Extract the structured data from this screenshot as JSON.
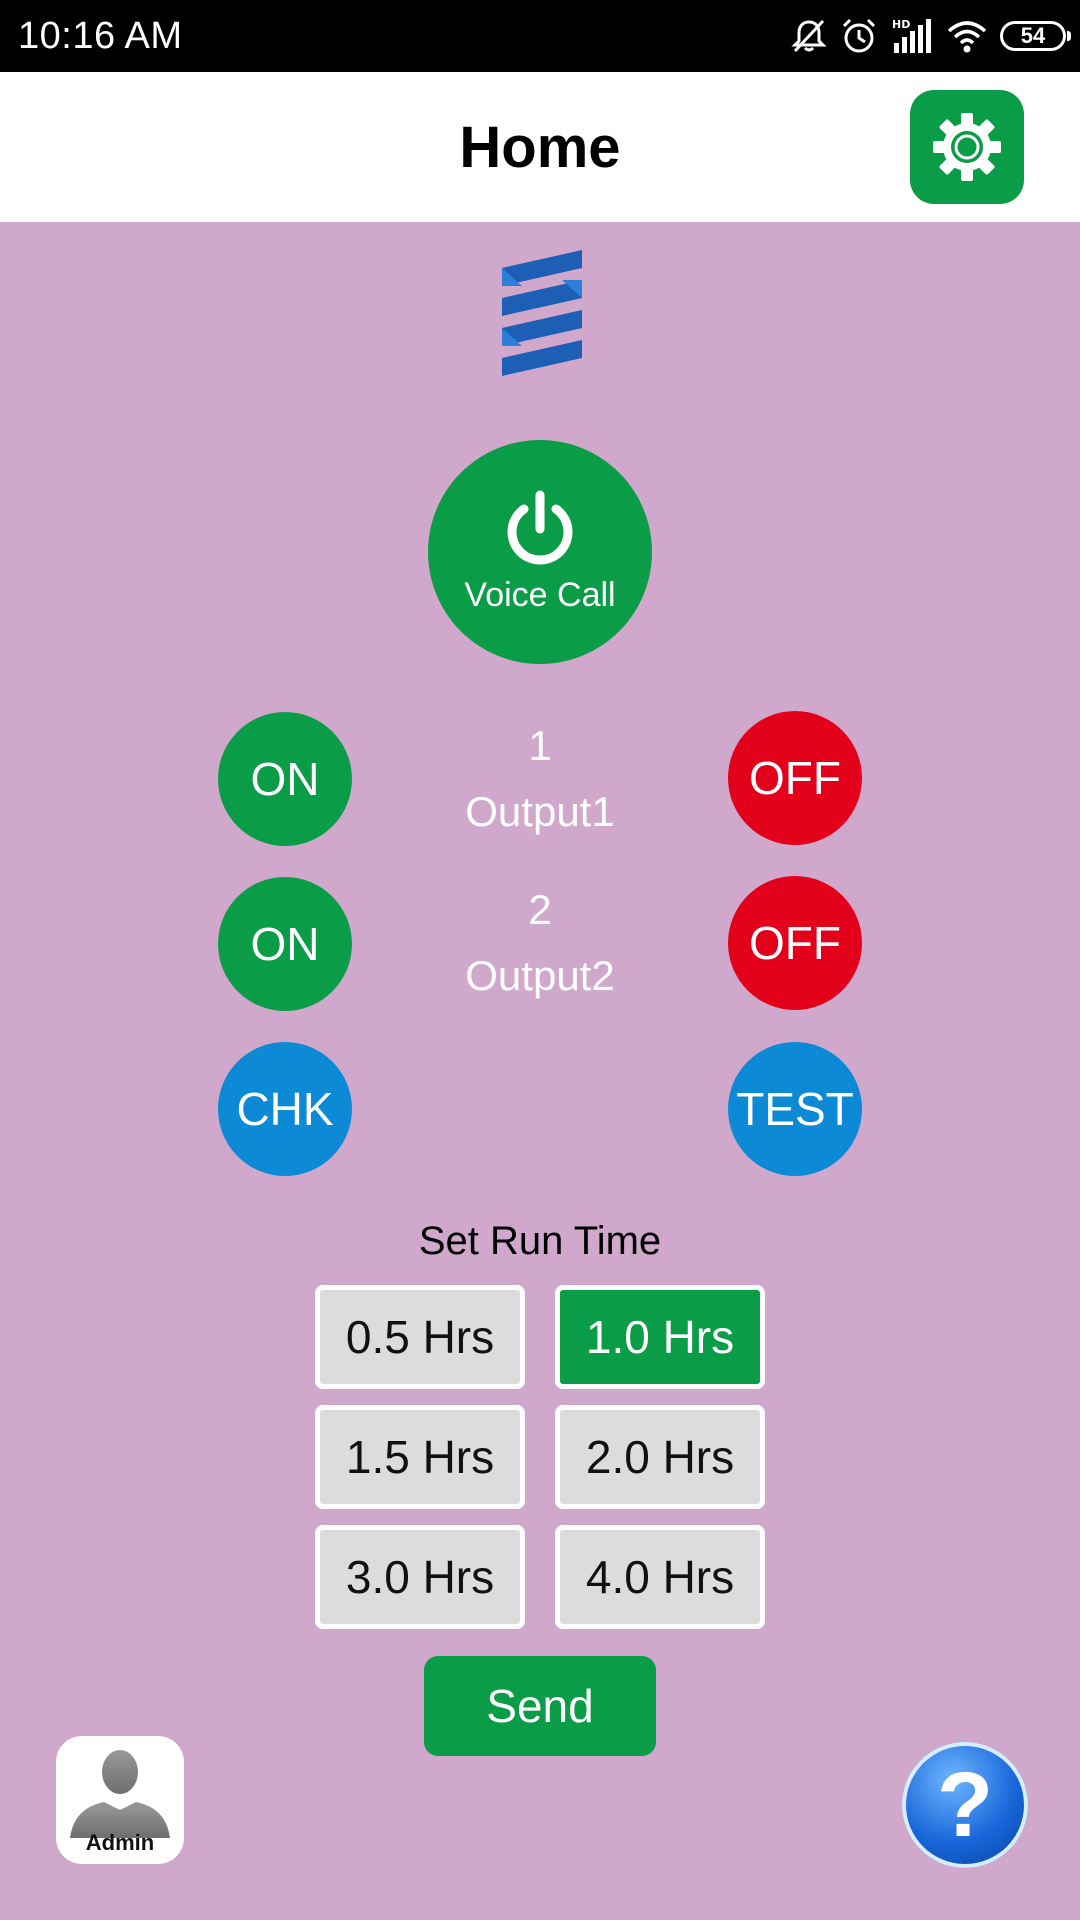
{
  "status_bar": {
    "time": "10:16  AM",
    "battery": "54"
  },
  "header": {
    "title": "Home"
  },
  "voice_call": {
    "label": "Voice Call"
  },
  "outputs": [
    {
      "number": "1",
      "name": "Output1",
      "on_label": "ON",
      "off_label": "OFF"
    },
    {
      "number": "2",
      "name": "Output2",
      "on_label": "ON",
      "off_label": "OFF"
    }
  ],
  "actions": {
    "check_label": "CHK",
    "test_label": "TEST"
  },
  "run_time": {
    "title": "Set Run Time",
    "options": [
      "0.5 Hrs",
      "1.0 Hrs",
      "1.5 Hrs",
      "2.0 Hrs",
      "3.0 Hrs",
      "4.0 Hrs"
    ],
    "selected": "1.0 Hrs"
  },
  "send_label": "Send",
  "admin_label": "Admin",
  "help_label": "?",
  "colors": {
    "background": "#cfa8cc",
    "green": "#0b9c47",
    "red": "#e3001b",
    "blue": "#0c8ad6"
  }
}
